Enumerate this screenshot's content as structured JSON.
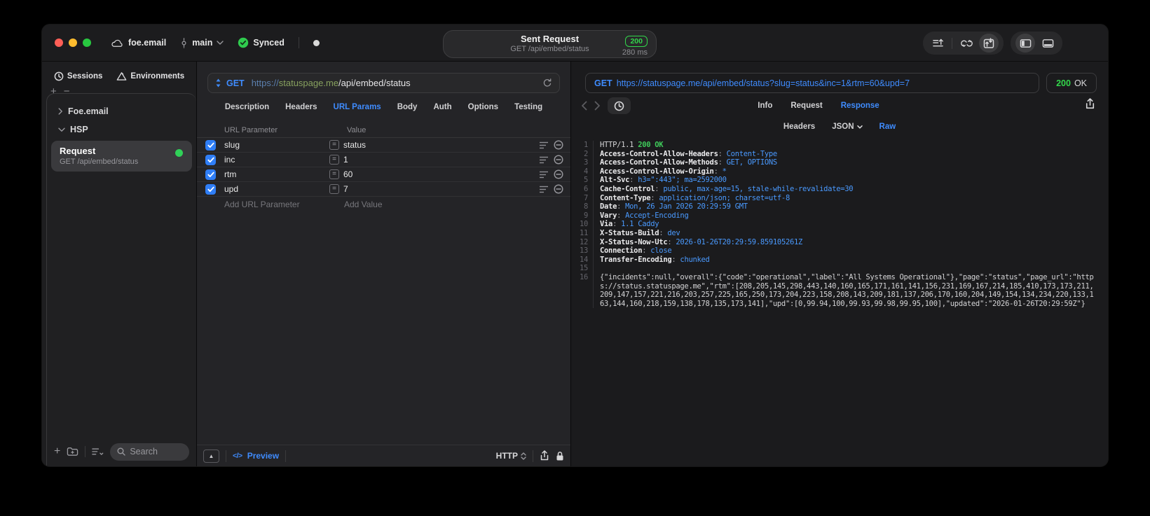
{
  "titlebar": {
    "project": "foe.email",
    "branch": "main",
    "sync_status": "Synced",
    "request_title": "Sent Request",
    "request_subtitle": "GET /api/embed/status",
    "status_badge": "200",
    "duration": "280 ms"
  },
  "sidebar": {
    "tabs": {
      "sessions": "Sessions",
      "environments": "Environments"
    },
    "tree": {
      "group1": "Foe.email",
      "group2": "HSP"
    },
    "request_item": {
      "title": "Request",
      "subtitle": "GET /api/embed/status"
    },
    "search_placeholder": "Search"
  },
  "request_pane": {
    "method": "GET",
    "url_scheme": "https://",
    "url_host": "statuspage.me",
    "url_path": "/api/embed/status",
    "tabs": [
      "Description",
      "Headers",
      "URL Params",
      "Body",
      "Auth",
      "Options",
      "Testing"
    ],
    "active_tab": "URL Params",
    "table": {
      "col_param": "URL Parameter",
      "col_value": "Value",
      "rows": [
        {
          "name": "slug",
          "value": "status",
          "enabled": true
        },
        {
          "name": "inc",
          "value": "1",
          "enabled": true
        },
        {
          "name": "rtm",
          "value": "60",
          "enabled": true
        },
        {
          "name": "upd",
          "value": "7",
          "enabled": true
        }
      ],
      "add_param": "Add URL Parameter",
      "add_value": "Add Value"
    },
    "footer": {
      "preview": "Preview",
      "protocol": "HTTP"
    }
  },
  "response_pane": {
    "method": "GET",
    "url": "https://statuspage.me/api/embed/status?slug=status&inc=1&rtm=60&upd=7",
    "status_code": "200",
    "status_text": "OK",
    "tabs": [
      "Info",
      "Request",
      "Response"
    ],
    "active_tab": "Response",
    "subtabs": [
      "Headers",
      "JSON",
      "Raw"
    ],
    "active_subtab": "Raw",
    "code_lines": [
      {
        "n": "1",
        "segs": [
          {
            "t": "HTTP/1.1 ",
            "c": "plain"
          },
          {
            "t": "200 OK",
            "c": "green"
          }
        ]
      },
      {
        "n": "2",
        "segs": [
          {
            "t": "Access-Control-Allow-Headers",
            "c": "name"
          },
          {
            "t": ": ",
            "c": "punct"
          },
          {
            "t": "Content-Type",
            "c": "val"
          }
        ]
      },
      {
        "n": "3",
        "segs": [
          {
            "t": "Access-Control-Allow-Methods",
            "c": "name"
          },
          {
            "t": ": ",
            "c": "punct"
          },
          {
            "t": "GET, OPTIONS",
            "c": "val"
          }
        ]
      },
      {
        "n": "4",
        "segs": [
          {
            "t": "Access-Control-Allow-Origin",
            "c": "name"
          },
          {
            "t": ": ",
            "c": "punct"
          },
          {
            "t": "*",
            "c": "val"
          }
        ]
      },
      {
        "n": "5",
        "segs": [
          {
            "t": "Alt-Svc",
            "c": "name"
          },
          {
            "t": ": ",
            "c": "punct"
          },
          {
            "t": "h3=\":443\"; ma=2592000",
            "c": "val"
          }
        ]
      },
      {
        "n": "6",
        "segs": [
          {
            "t": "Cache-Control",
            "c": "name"
          },
          {
            "t": ": ",
            "c": "punct"
          },
          {
            "t": "public, max-age=15, stale-while-revalidate=30",
            "c": "val"
          }
        ]
      },
      {
        "n": "7",
        "segs": [
          {
            "t": "Content-Type",
            "c": "name"
          },
          {
            "t": ": ",
            "c": "punct"
          },
          {
            "t": "application/json; charset=utf-8",
            "c": "val"
          }
        ]
      },
      {
        "n": "8",
        "segs": [
          {
            "t": "Date",
            "c": "name"
          },
          {
            "t": ": ",
            "c": "punct"
          },
          {
            "t": "Mon, 26 Jan 2026 20:29:59 GMT",
            "c": "val"
          }
        ]
      },
      {
        "n": "9",
        "segs": [
          {
            "t": "Vary",
            "c": "name"
          },
          {
            "t": ": ",
            "c": "punct"
          },
          {
            "t": "Accept-Encoding",
            "c": "val"
          }
        ]
      },
      {
        "n": "10",
        "segs": [
          {
            "t": "Via",
            "c": "name"
          },
          {
            "t": ": ",
            "c": "punct"
          },
          {
            "t": "1.1 Caddy",
            "c": "val"
          }
        ]
      },
      {
        "n": "11",
        "segs": [
          {
            "t": "X-Status-Build",
            "c": "name"
          },
          {
            "t": ": ",
            "c": "punct"
          },
          {
            "t": "dev",
            "c": "val"
          }
        ]
      },
      {
        "n": "12",
        "segs": [
          {
            "t": "X-Status-Now-Utc",
            "c": "name"
          },
          {
            "t": ": ",
            "c": "punct"
          },
          {
            "t": "2026-01-26T20:29:59.859105261Z",
            "c": "val"
          }
        ]
      },
      {
        "n": "13",
        "segs": [
          {
            "t": "Connection",
            "c": "name"
          },
          {
            "t": ": ",
            "c": "punct"
          },
          {
            "t": "close",
            "c": "val"
          }
        ]
      },
      {
        "n": "14",
        "segs": [
          {
            "t": "Transfer-Encoding",
            "c": "name"
          },
          {
            "t": ": ",
            "c": "punct"
          },
          {
            "t": "chunked",
            "c": "val"
          }
        ]
      },
      {
        "n": "15",
        "segs": []
      },
      {
        "n": "16",
        "segs": [
          {
            "t": "{\"incidents\":null,\"overall\":{\"code\":\"operational\",\"label\":\"All Systems Operational\"},\"page\":\"status\",\"page_url\":\"https://status.statuspage.me\",\"rtm\":[208,205,145,298,443,140,160,165,171,161,141,156,231,169,167,214,185,410,173,173,211,209,147,157,221,216,203,257,225,165,250,173,204,223,158,208,143,209,181,137,206,170,160,204,149,154,134,234,220,133,163,144,160,218,159,138,178,135,173,141],\"upd\":[0,99.94,100,99.93,99.98,99.95,100],\"updated\":\"2026-01-26T20:29:59Z\"}",
            "c": "plain"
          }
        ]
      }
    ]
  },
  "icons": {
    "collapse_up": "▲",
    "preview_code": "</>",
    "plus": "+",
    "minus": "−",
    "equals": "="
  },
  "colors": {
    "accent": "#3f8cff",
    "success": "#32d74b",
    "selected_bg": "#3a3a3d"
  }
}
